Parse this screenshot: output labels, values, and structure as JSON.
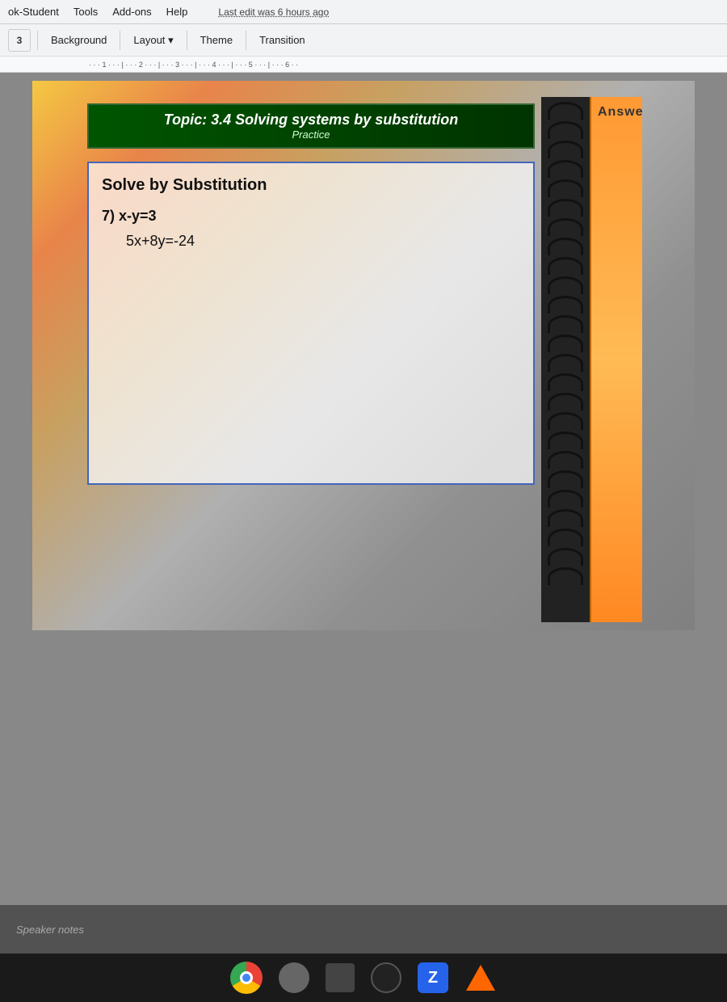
{
  "menubar": {
    "items": [
      {
        "label": "ok-Student"
      },
      {
        "label": "Tools"
      },
      {
        "label": "Add-ons"
      },
      {
        "label": "Help"
      }
    ],
    "last_edit": "Last edit was 6 hours ago"
  },
  "toolbar": {
    "background_label": "Background",
    "layout_label": "Layout",
    "layout_arrow": "▾",
    "theme_label": "Theme",
    "transition_label": "Transition",
    "icon_num": "3"
  },
  "ruler": {
    "marks": "· · · 1 · · · | · · · 2 · · · | · · · 3 · · · | · · · 4 · · · | · · · 5 · · · | · · · 6 · ·"
  },
  "slide": {
    "topic_title": "Topic: 3.4 Solving systems by substitution",
    "topic_subtitle": "Practice",
    "content_heading": "Solve by Substitution",
    "problem_number": "7)  x-y=3",
    "equation": "5x+8y=-24",
    "answer_label": "Answe"
  },
  "speaker_notes": {
    "label": "Speaker notes"
  },
  "taskbar": {
    "icons": [
      {
        "name": "chrome-icon",
        "type": "chrome"
      },
      {
        "name": "apps-icon",
        "type": "circle-gray"
      },
      {
        "name": "grid-icon",
        "type": "grid"
      },
      {
        "name": "clock-icon",
        "type": "circle-dark"
      },
      {
        "name": "zoom-icon",
        "type": "Z"
      },
      {
        "name": "triangle-icon",
        "type": "triangle"
      }
    ]
  }
}
